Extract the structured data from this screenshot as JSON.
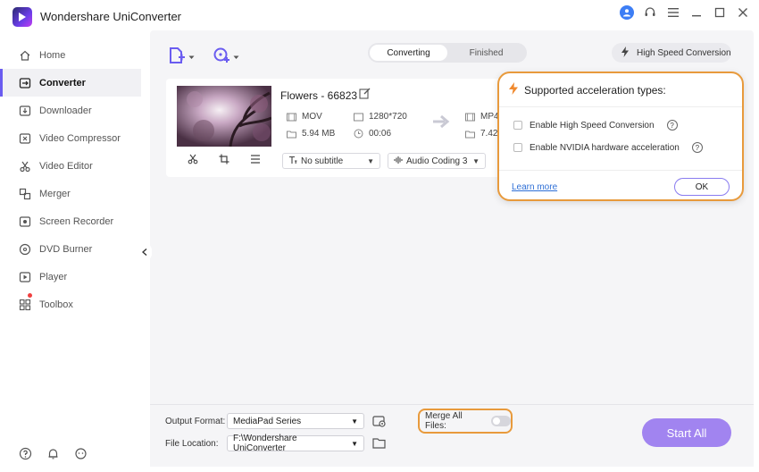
{
  "app": {
    "title": "Wondershare UniConverter",
    "accent": "#6a5cf0"
  },
  "sidebar": {
    "items": [
      {
        "label": "Home",
        "icon": "home-icon"
      },
      {
        "label": "Converter",
        "icon": "converter-icon",
        "active": true
      },
      {
        "label": "Downloader",
        "icon": "downloader-icon"
      },
      {
        "label": "Video Compressor",
        "icon": "compressor-icon"
      },
      {
        "label": "Video Editor",
        "icon": "scissors-icon"
      },
      {
        "label": "Merger",
        "icon": "merger-icon"
      },
      {
        "label": "Screen Recorder",
        "icon": "recorder-icon"
      },
      {
        "label": "DVD Burner",
        "icon": "disc-icon"
      },
      {
        "label": "Player",
        "icon": "play-icon"
      },
      {
        "label": "Toolbox",
        "icon": "grid-icon"
      }
    ]
  },
  "tabs": {
    "converting": "Converting",
    "finished": "Finished"
  },
  "high_speed": {
    "label": "High Speed Conversion"
  },
  "file": {
    "title": "Flowers - 66823",
    "src_format": "MOV",
    "src_size": "5.94 MB",
    "resolution": "1280*720",
    "duration": "00:06",
    "dst_format": "MP4",
    "dst_size": "7.42",
    "subtitle": "No subtitle",
    "audio": "Audio Coding 3"
  },
  "popup": {
    "title": "Supported acceleration types:",
    "option1": "Enable High Speed Conversion",
    "option2": "Enable NVIDIA hardware acceleration",
    "help": "?",
    "learn_more": "Learn more",
    "ok": "OK"
  },
  "bottom": {
    "output_format_label": "Output Format:",
    "output_format_value": "MediaPad Series",
    "file_location_label": "File Location:",
    "file_location_value": "F:\\Wondershare UniConverter",
    "merge_label": "Merge All Files:",
    "start_all": "Start All"
  }
}
